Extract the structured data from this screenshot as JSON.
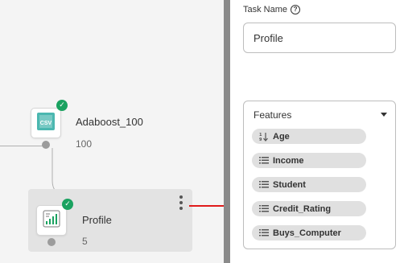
{
  "canvas": {
    "nodes": [
      {
        "title": "Adaboost_100",
        "count": "100",
        "icon": "csv-file-icon",
        "status": "success"
      },
      {
        "title": "Profile",
        "count": "5",
        "icon": "profile-chart-icon",
        "status": "success"
      }
    ]
  },
  "panel": {
    "task_name_label": "Task Name",
    "task_name_value": "Profile",
    "features_label": "Features",
    "features": [
      {
        "label": "Age",
        "icon": "numeric-sort-icon"
      },
      {
        "label": "Income",
        "icon": "list-icon"
      },
      {
        "label": "Student",
        "icon": "list-icon"
      },
      {
        "label": "Credit_Rating",
        "icon": "list-icon"
      },
      {
        "label": "Buys_Computer",
        "icon": "list-icon"
      }
    ]
  },
  "colors": {
    "success": "#1aa260",
    "arrow": "#e01b1b",
    "divider": "#8a8a8a"
  }
}
